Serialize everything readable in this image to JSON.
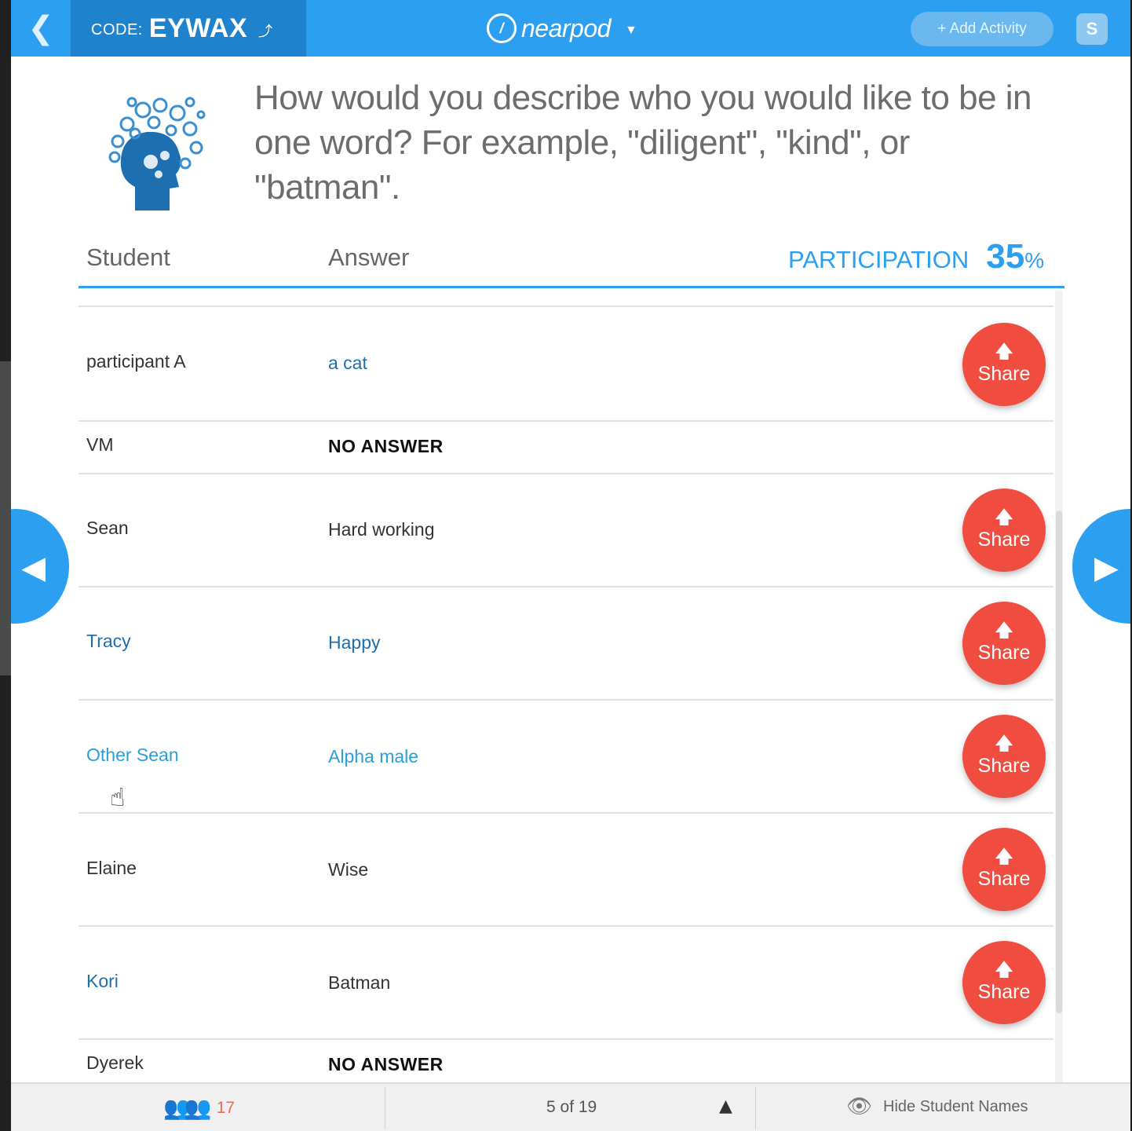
{
  "header": {
    "code_label": "CODE:",
    "code_value": "EYWAX",
    "brand_name": "nearpod",
    "add_activity_label": "+ Add Activity",
    "user_initial": "S"
  },
  "question": {
    "text": "How would you describe who you would like to be in one word?  For example, \"diligent\", \"kind\", or \"batman\"."
  },
  "table": {
    "col_student": "Student",
    "col_answer": "Answer",
    "participation_label": "PARTICIPATION",
    "participation_value": "35",
    "participation_unit": "%",
    "share_label": "Share",
    "rows": [
      {
        "student": "participant A",
        "answer": "a cat"
      },
      {
        "student": "VM",
        "answer": "NO ANSWER"
      },
      {
        "student": "Sean",
        "answer": "Hard working"
      },
      {
        "student": "Tracy",
        "answer": "Happy"
      },
      {
        "student": "Other Sean",
        "answer": "Alpha male"
      },
      {
        "student": "Elaine",
        "answer": "Wise"
      },
      {
        "student": "Kori",
        "answer": "Batman"
      },
      {
        "student": "Dyerek",
        "answer": "NO ANSWER"
      }
    ]
  },
  "footer": {
    "students_count": "17",
    "slide_position": "5 of 19",
    "hide_names_label": "Hide Student Names"
  },
  "colors": {
    "primary": "#2c9ff0",
    "code_box": "#1f82cc",
    "share": "#f04c3f",
    "highlight": "#2a9fd6"
  }
}
